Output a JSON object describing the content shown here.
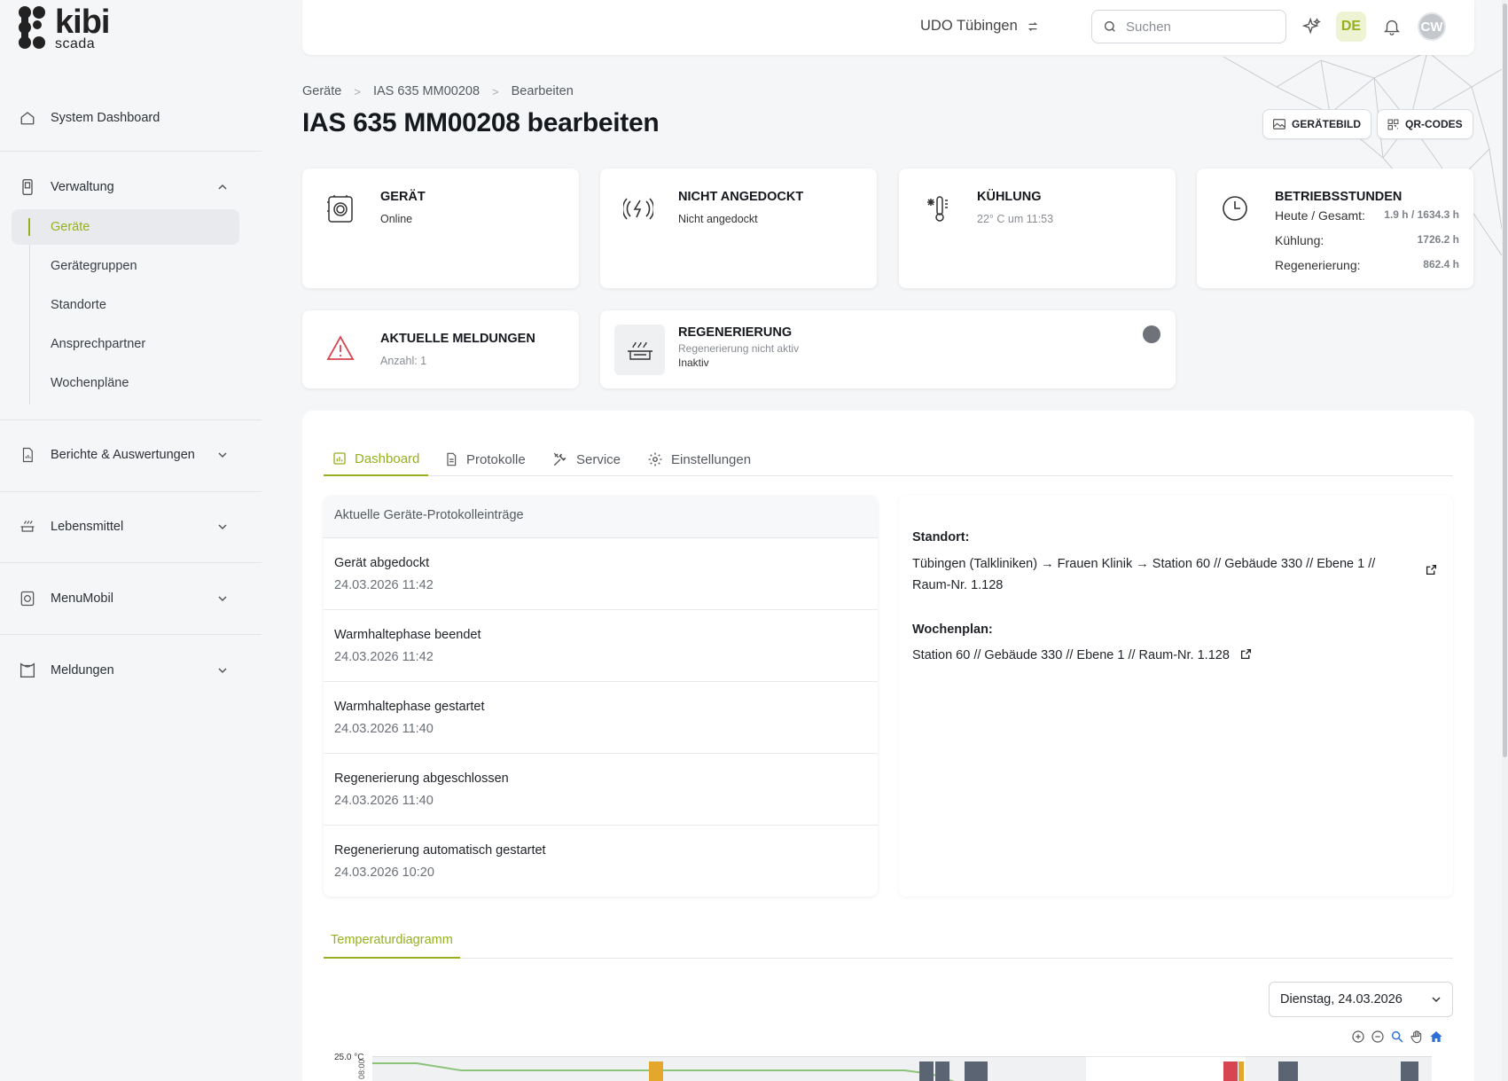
{
  "app": {
    "logo_main": "kibi",
    "logo_sub": "scada"
  },
  "sidebar": {
    "dashboard": "System Dashboard",
    "verwaltung": "Verwaltung",
    "sub": [
      "Geräte",
      "Gerätegruppen",
      "Standorte",
      "Ansprechpartner",
      "Wochenpläne"
    ],
    "berichte": "Berichte & Auswertungen",
    "lebensmittel": "Lebensmittel",
    "menumobil": "MenuMobil",
    "meldungen": "Meldungen"
  },
  "topbar": {
    "org": "UDO Tübingen",
    "search_placeholder": "Suchen",
    "lang": "DE",
    "avatar": "CW"
  },
  "header": {
    "breadcrumb": [
      "Geräte",
      "IAS 635 MM00208",
      "Bearbeiten"
    ],
    "title": "IAS 635 MM00208 bearbeiten",
    "btn_image": "GERÄTEBILD",
    "btn_qr": "QR-CODES"
  },
  "cards": {
    "geraet": {
      "title": "GERÄT",
      "status": "Online"
    },
    "dock": {
      "title": "NICHT ANGEDOCKT",
      "status": "Nicht angedockt"
    },
    "kuehlung": {
      "title": "KÜHLUNG",
      "status": "22° C um 11:53"
    },
    "betrieb": {
      "title": "BETRIEBSSTUNDEN",
      "rows": [
        {
          "label": "Heute / Gesamt:",
          "value": "1.9 h / 1634.3 h"
        },
        {
          "label": "Kühlung:",
          "value": "1726.2 h"
        },
        {
          "label": "Regenerierung:",
          "value": "862.4 h"
        }
      ]
    },
    "meldungen": {
      "title": "AKTUELLE MELDUNGEN",
      "status": "Anzahl: 1"
    },
    "regen": {
      "title": "REGENERIERUNG",
      "sub": "Regenerierung nicht aktiv",
      "status": "Inaktiv"
    }
  },
  "tabs": [
    "Dashboard",
    "Protokolle",
    "Service",
    "Einstellungen"
  ],
  "log": {
    "title": "Aktuelle Geräte-Protokolleinträge",
    "rows": [
      {
        "text": "Gerät abgedockt",
        "date": "24.03.2026 11:42"
      },
      {
        "text": "Warmhaltephase beendet",
        "date": "24.03.2026 11:42"
      },
      {
        "text": "Warmhaltephase gestartet",
        "date": "24.03.2026 11:40"
      },
      {
        "text": "Regenerierung abgeschlossen",
        "date": "24.03.2026 11:40"
      },
      {
        "text": "Regenerierung automatisch gestartet",
        "date": "24.03.2026 10:20"
      }
    ]
  },
  "location": {
    "standort_label": "Standort:",
    "standort_line1": "Tübingen (Talkliniken) → Frauen Klinik → Station 60 // Gebäude 330 // Ebene 1 //",
    "standort_line2": "Raum-Nr. 1.128",
    "wochenplan_label": "Wochenplan:",
    "wochenplan": "Station 60 // Gebäude 330 // Ebene 1 // Raum-Nr. 1.128"
  },
  "chart_section": {
    "tab": "Temperaturdiagramm",
    "date": "Dienstag, 24.03.2026",
    "ylabel_top": "25.0 °C",
    "xlabel_first": "08:00"
  },
  "colors": {
    "accent": "#95b11d",
    "alert": "#d64550"
  }
}
